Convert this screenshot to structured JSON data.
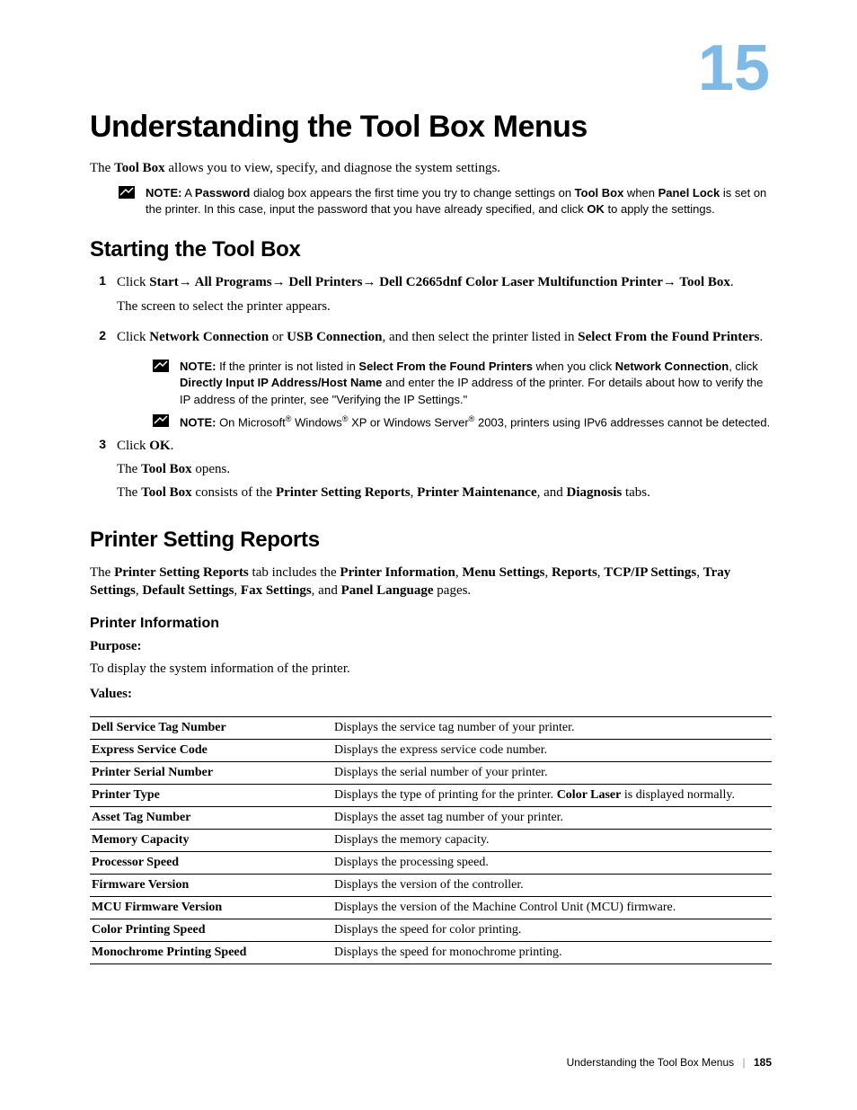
{
  "chapterNumber": "15",
  "title": "Understanding the Tool Box Menus",
  "intro": {
    "prefix": "The ",
    "toolbox": "Tool Box",
    "suffix": " allows you to view, specify, and diagnose the system settings."
  },
  "note1": {
    "label": "NOTE:",
    "t1": " A ",
    "password": "Password",
    "t2": " dialog box appears the first time you try to change settings on ",
    "toolbox": "Tool Box",
    "t3": " when ",
    "panellock": "Panel Lock",
    "t4": " is set on the printer. In this case, input the password that you have already specified, and click ",
    "ok": "OK",
    "t5": " to apply the settings."
  },
  "section1": {
    "heading": "Starting the Tool Box",
    "step1": {
      "num": "1",
      "t1": "Click ",
      "start": "Start",
      "allprograms": " All Programs",
      "dellprinters": " Dell Printers",
      "model": " Dell C2665dnf Color Laser Multifunction Printer",
      "toolbox": " Tool Box",
      "period": ".",
      "sub": "The screen to select the printer appears."
    },
    "step2": {
      "num": "2",
      "t1": "Click ",
      "net": "Network Connection",
      "or": " or ",
      "usb": "USB Connection",
      "t2": ", and then select the printer listed in ",
      "select": "Select From the Found Printers",
      "period": "."
    },
    "note2a": {
      "label": "NOTE:",
      "t1": " If the printer is not listed in ",
      "select": "Select From the Found Printers",
      "t2": " when you click ",
      "net": "Network Connection",
      "t3": ", click ",
      "direct": "Directly Input IP Address/Host Name",
      "t4": " and enter the IP address of the printer. For details about how to verify the IP address of the printer, see \"Verifying the IP Settings.\""
    },
    "note2b": {
      "label": "NOTE:",
      "t1": " On Microsoft",
      "t2": " Windows",
      "t3": " XP or Windows Server",
      "t4": " 2003, printers using IPv6 addresses cannot be detected."
    },
    "step3": {
      "num": "3",
      "t1": "Click ",
      "ok": "OK",
      "period": ".",
      "sub1a": "The ",
      "sub1b": "Tool Box",
      "sub1c": " opens.",
      "sub2a": "The ",
      "sub2b": "Tool Box",
      "sub2c": " consists of the ",
      "sub2d": "Printer Setting Reports",
      "sub2e": ", ",
      "sub2f": "Printer Maintenance",
      "sub2g": ", and ",
      "sub2h": "Diagnosis",
      "sub2i": " tabs."
    }
  },
  "section2": {
    "heading": "Printer Setting Reports",
    "p1a": "The ",
    "p1b": "Printer Setting Reports",
    "p1c": " tab includes the ",
    "p1d": "Printer Information",
    "p1e": ", ",
    "p1f": "Menu Settings",
    "p1g": ", ",
    "p1h": "Reports",
    "p1i": ", ",
    "p1j": "TCP/IP Settings",
    "p1k": ", ",
    "p1l": "Tray Settings",
    "p1m": ", ",
    "p1n": "Default Settings",
    "p1o": ", ",
    "p1p": "Fax Settings",
    "p1q": ", and ",
    "p1r": "Panel Language",
    "p1s": " pages.",
    "subheading": "Printer Information",
    "purposeLabel": "Purpose:",
    "purposeText": "To display the system information of the printer.",
    "valuesLabel": "Values:",
    "rows": [
      {
        "k": "Dell Service Tag Number",
        "v": "Displays the service tag number of your printer."
      },
      {
        "k": "Express Service Code",
        "v": "Displays the express service code number."
      },
      {
        "k": "Printer Serial Number",
        "v": "Displays the serial number of your printer."
      },
      {
        "k": "Printer Type",
        "va": "Displays the type of printing for the printer. ",
        "vb": "Color Laser",
        "vc": " is displayed normally."
      },
      {
        "k": "Asset Tag Number",
        "v": "Displays the asset tag number of your printer."
      },
      {
        "k": "Memory Capacity",
        "v": "Displays the memory capacity."
      },
      {
        "k": "Processor Speed",
        "v": "Displays the processing speed."
      },
      {
        "k": "Firmware Version",
        "v": "Displays the version of the controller."
      },
      {
        "k": "MCU Firmware Version",
        "v": "Displays the version of the Machine Control Unit (MCU) firmware."
      },
      {
        "k": "Color Printing Speed",
        "v": "Displays the speed for color printing."
      },
      {
        "k": "Monochrome Printing Speed",
        "v": "Displays the speed for monochrome printing."
      }
    ]
  },
  "footer": {
    "text": "Understanding the Tool Box Menus",
    "page": "185"
  }
}
